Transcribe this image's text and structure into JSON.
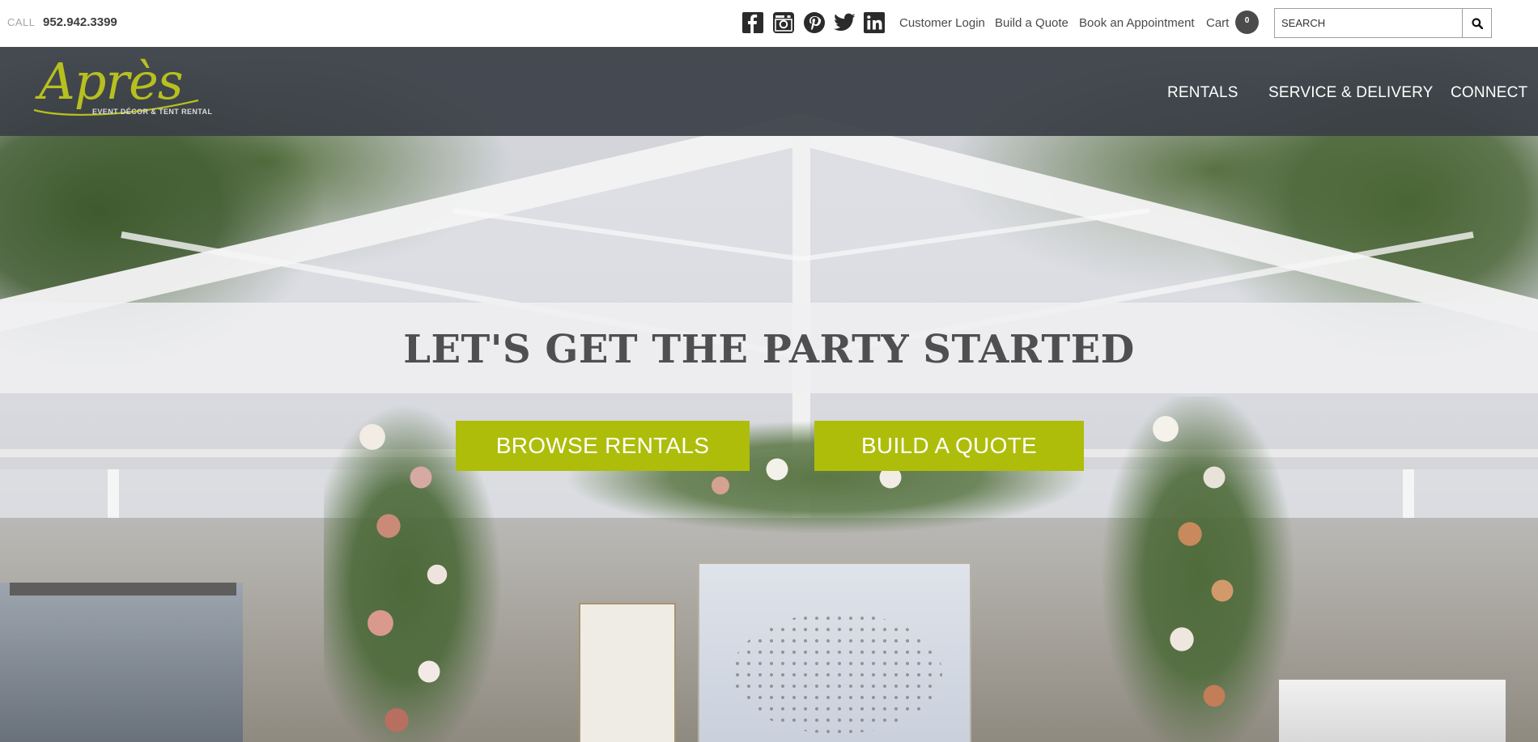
{
  "topbar": {
    "call_label": "CALL",
    "phone": "952.942.3399",
    "social": [
      {
        "name": "facebook-icon"
      },
      {
        "name": "instagram-icon"
      },
      {
        "name": "pinterest-icon"
      },
      {
        "name": "twitter-icon"
      },
      {
        "name": "linkedin-icon"
      }
    ],
    "links": {
      "customer_login": "Customer Login",
      "build_quote": "Build a Quote",
      "book_appointment": "Book an Appointment",
      "cart": "Cart"
    },
    "cart_count": "0",
    "search": {
      "placeholder": "SEARCH"
    }
  },
  "brand": {
    "logo_text": "Après",
    "tagline": "EVENT DÉCOR & TENT RENTAL",
    "accent_color": "#aebd0a"
  },
  "nav": {
    "items": [
      "RENTALS",
      "SERVICE & DELIVERY",
      "CONNECT"
    ]
  },
  "hero": {
    "headline": "LET'S GET THE PARTY STARTED",
    "buttons": {
      "browse": "BROWSE RENTALS",
      "quote": "BUILD A QUOTE"
    }
  }
}
